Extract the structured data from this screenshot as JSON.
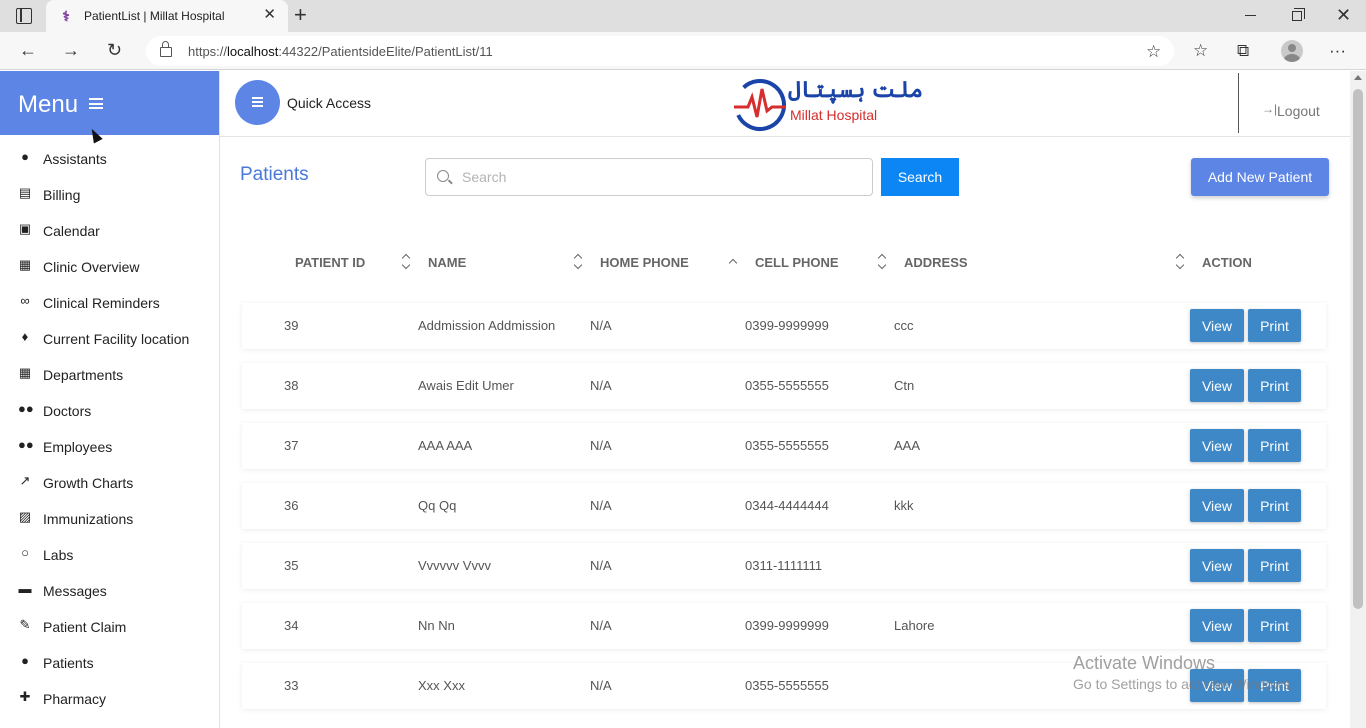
{
  "browser": {
    "tab_title": "PatientList | Millat Hospital",
    "url_prefix": "https://",
    "url_host": "localhost",
    "url_rest": ":44322/PatientsideElite/PatientList/11"
  },
  "sidebar": {
    "title": "Menu",
    "items": [
      {
        "label": "Assistants",
        "icon": "person-icon"
      },
      {
        "label": "Billing",
        "icon": "clipboard-icon"
      },
      {
        "label": "Calendar",
        "icon": "calendar-icon"
      },
      {
        "label": "Clinic Overview",
        "icon": "building-icon"
      },
      {
        "label": "Clinical Reminders",
        "icon": "link-icon"
      },
      {
        "label": "Current Facility location",
        "icon": "location-pin-icon"
      },
      {
        "label": "Departments",
        "icon": "building-icon"
      },
      {
        "label": "Doctors",
        "icon": "people-icon"
      },
      {
        "label": "Employees",
        "icon": "people-icon"
      },
      {
        "label": "Growth Charts",
        "icon": "trending-up-icon"
      },
      {
        "label": "Immunizations",
        "icon": "texture-icon"
      },
      {
        "label": "Labs",
        "icon": "circle-icon"
      },
      {
        "label": "Messages",
        "icon": "message-icon"
      },
      {
        "label": "Patient Claim",
        "icon": "pencil-icon"
      },
      {
        "label": "Patients",
        "icon": "person-icon"
      },
      {
        "label": "Pharmacy",
        "icon": "pharmacy-icon"
      }
    ]
  },
  "topbar": {
    "quick_access": "Quick Access",
    "logo_urdu": "ملت ہسپتال",
    "logo_en": "Millat Hospital",
    "logout": "Logout"
  },
  "main": {
    "title": "Patients",
    "search_placeholder": "Search",
    "search_button": "Search",
    "add_button": "Add New Patient",
    "columns": {
      "patient_id": "PATIENT ID",
      "name": "NAME",
      "home_phone": "HOME PHONE",
      "cell_phone": "CELL PHONE",
      "address": "ADDRESS",
      "action": "ACTION"
    },
    "view_label": "View",
    "print_label": "Print",
    "rows": [
      {
        "id": "39",
        "name": "Addmission Addmission",
        "home": "N/A",
        "cell": "0399-9999999",
        "address": "ccc"
      },
      {
        "id": "38",
        "name": "Awais Edit Umer",
        "home": "N/A",
        "cell": "0355-5555555",
        "address": "Ctn"
      },
      {
        "id": "37",
        "name": "AAA AAA",
        "home": "N/A",
        "cell": "0355-5555555",
        "address": "AAA"
      },
      {
        "id": "36",
        "name": "Qq Qq",
        "home": "N/A",
        "cell": "0344-4444444",
        "address": "kkk"
      },
      {
        "id": "35",
        "name": "Vvvvvv Vvvv",
        "home": "N/A",
        "cell": "0311-1111111",
        "address": ""
      },
      {
        "id": "34",
        "name": "Nn Nn",
        "home": "N/A",
        "cell": "0399-9999999",
        "address": "Lahore"
      },
      {
        "id": "33",
        "name": "Xxx Xxx",
        "home": "N/A",
        "cell": "0355-5555555",
        "address": ""
      }
    ]
  },
  "watermark": {
    "title": "Activate Windows",
    "subtitle": "Go to Settings to activate Windows."
  },
  "colors": {
    "accent": "#5c85e6",
    "search_button": "#0d86f5",
    "action_button": "#3e88c8",
    "title": "#4a78d8"
  }
}
